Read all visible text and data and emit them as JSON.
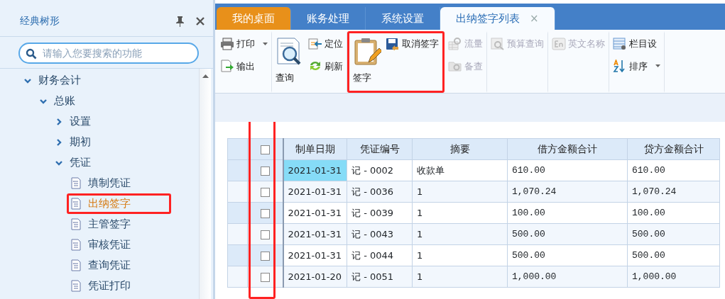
{
  "sidebar": {
    "title": "经典树形",
    "search": {
      "placeholder": "请输入您要搜索的功能"
    },
    "tree": [
      {
        "label": "财务会计",
        "kind": "folder",
        "expanded": true,
        "selected": false,
        "highlighted": false,
        "children": [
          {
            "label": "总账",
            "kind": "folder",
            "expanded": true,
            "selected": false,
            "highlighted": false,
            "children": [
              {
                "label": "设置",
                "kind": "folder",
                "expanded": false,
                "selected": false,
                "highlighted": false
              },
              {
                "label": "期初",
                "kind": "folder",
                "expanded": false,
                "selected": false,
                "highlighted": false
              },
              {
                "label": "凭证",
                "kind": "folder",
                "expanded": true,
                "selected": false,
                "highlighted": false,
                "children": [
                  {
                    "label": "填制凭证",
                    "kind": "leaf",
                    "selected": false,
                    "highlighted": false
                  },
                  {
                    "label": "出纳签字",
                    "kind": "leaf",
                    "selected": true,
                    "highlighted": true
                  },
                  {
                    "label": "主管签字",
                    "kind": "leaf",
                    "selected": false,
                    "highlighted": false
                  },
                  {
                    "label": "审核凭证",
                    "kind": "leaf",
                    "selected": false,
                    "highlighted": false
                  },
                  {
                    "label": "查询凭证",
                    "kind": "leaf",
                    "selected": false,
                    "highlighted": false
                  },
                  {
                    "label": "凭证打印",
                    "kind": "leaf",
                    "selected": false,
                    "highlighted": false
                  }
                ]
              }
            ]
          }
        ]
      }
    ]
  },
  "tabs": [
    {
      "label": "我的桌面",
      "kind": "home",
      "selected": false,
      "closable": false
    },
    {
      "label": "账务处理",
      "kind": "plain",
      "selected": false,
      "closable": false
    },
    {
      "label": "系统设置",
      "kind": "plain",
      "selected": false,
      "closable": false
    },
    {
      "label": "出纳签字列表",
      "kind": "plain",
      "selected": true,
      "closable": true,
      "close": "×"
    }
  ],
  "toolbar": [
    {
      "highlighted": false,
      "items": [
        {
          "label": "打印",
          "kind": "small",
          "disabled": false,
          "dropdown": true
        },
        {
          "label": "输出",
          "kind": "small",
          "disabled": false,
          "dropdown": false
        }
      ]
    },
    {
      "highlighted": false,
      "items": [
        {
          "label": "查询",
          "kind": "large",
          "disabled": false,
          "dropdown": false
        },
        {
          "label": "定位",
          "kind": "small",
          "disabled": false,
          "dropdown": false
        },
        {
          "label": "刷新",
          "kind": "small",
          "disabled": false,
          "dropdown": false
        }
      ]
    },
    {
      "highlighted": true,
      "items": [
        {
          "label": "签字",
          "kind": "large",
          "disabled": false,
          "dropdown": false
        },
        {
          "label": "取消签字",
          "kind": "small",
          "disabled": false,
          "dropdown": false
        }
      ]
    },
    {
      "highlighted": false,
      "items": [
        {
          "label": "流量",
          "kind": "small",
          "disabled": true,
          "dropdown": false
        },
        {
          "label": "备查",
          "kind": "small",
          "disabled": true,
          "dropdown": false
        }
      ]
    },
    {
      "highlighted": false,
      "items": [
        {
          "label": "预算查询",
          "kind": "small",
          "disabled": true,
          "dropdown": false
        }
      ]
    },
    {
      "highlighted": false,
      "items": [
        {
          "label": "英文名称",
          "kind": "small",
          "disabled": true,
          "dropdown": false
        }
      ]
    },
    {
      "highlighted": false,
      "items": [
        {
          "label": "栏目设",
          "kind": "small",
          "disabled": false,
          "dropdown": false
        },
        {
          "label": "排序",
          "kind": "small",
          "disabled": false,
          "dropdown": true
        }
      ]
    }
  ],
  "table": {
    "checkbox_column_highlighted": true,
    "select_all": {
      "checked": false
    },
    "columns": [
      "制单日期",
      "凭证编号",
      "摘要",
      "借方金额合计",
      "贷方金额合计"
    ],
    "rows": [
      {
        "checked": false,
        "selected": true,
        "cells": [
          "2021-01-31",
          "记 - 0002",
          "收款单",
          "610.00",
          "610.00"
        ]
      },
      {
        "checked": false,
        "selected": false,
        "cells": [
          "2021-01-31",
          "记 - 0036",
          "1",
          "1,070.24",
          "1,070.24"
        ]
      },
      {
        "checked": false,
        "selected": false,
        "cells": [
          "2021-01-31",
          "记 - 0039",
          "1",
          "100.00",
          "100.00"
        ]
      },
      {
        "checked": false,
        "selected": false,
        "cells": [
          "2021-01-31",
          "记 - 0043",
          "1",
          "500.00",
          "500.00"
        ]
      },
      {
        "checked": false,
        "selected": false,
        "cells": [
          "2021-01-31",
          "记 - 0044",
          "1",
          "500.00",
          "500.00"
        ]
      },
      {
        "checked": false,
        "selected": false,
        "cells": [
          "2021-01-20",
          "记 - 0051",
          "1",
          "1,000.00",
          "1,000.00"
        ]
      }
    ]
  }
}
